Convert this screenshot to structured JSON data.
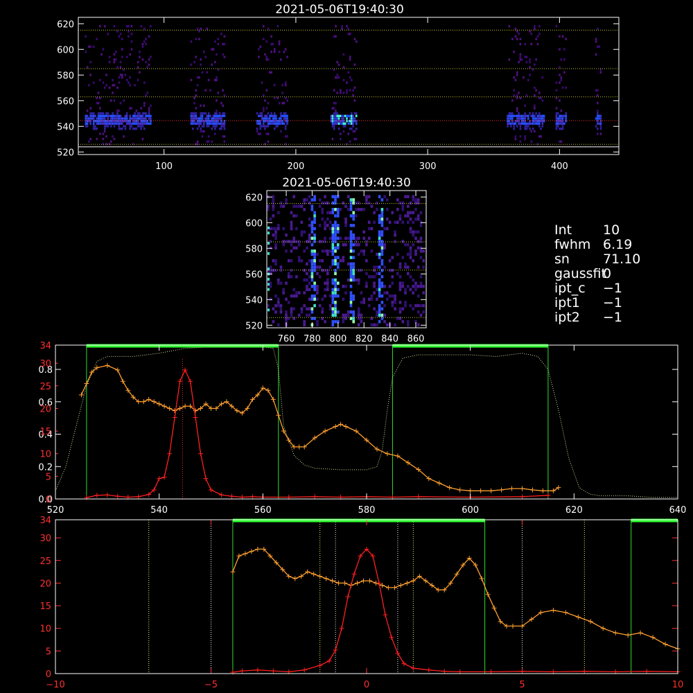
{
  "panel1": {
    "title": "2021-05-06T19:40:30",
    "xticks": [
      100,
      200,
      300,
      400
    ],
    "yticks": [
      520,
      540,
      560,
      580,
      600,
      620
    ],
    "xlim": [
      35,
      445
    ],
    "ylim": [
      518,
      625
    ],
    "hlines": [
      {
        "y": 615,
        "color": "#c8c832"
      },
      {
        "y": 585,
        "color": "#c8c832"
      },
      {
        "y": 563,
        "color": "#c8c832"
      },
      {
        "y": 544.5,
        "color": "#ff3030"
      },
      {
        "y": 526,
        "color": "#c8c832"
      },
      {
        "y": 524,
        "color": "#ffffff"
      }
    ],
    "bands": [
      [
        40,
        90
      ],
      [
        120,
        146
      ],
      [
        170,
        193
      ],
      [
        226,
        246
      ],
      [
        360,
        388
      ],
      [
        397,
        405
      ],
      [
        427,
        431
      ]
    ]
  },
  "panel2": {
    "title": "2021-05-06T19:40:30",
    "xticks": [
      760,
      780,
      800,
      820,
      840,
      860
    ],
    "yticks": [
      520,
      540,
      560,
      580,
      600,
      620
    ],
    "xlim": [
      745,
      868
    ],
    "ylim": [
      518,
      625
    ],
    "hlines": [
      {
        "y": 615,
        "color": "#c8c832"
      },
      {
        "y": 585,
        "color": "#c8c832"
      },
      {
        "y": 563,
        "color": "#c8c832"
      },
      {
        "y": 526,
        "color": "#c8c832"
      }
    ],
    "streaks": [
      780,
      797,
      810,
      832
    ]
  },
  "info": [
    {
      "key": "Int",
      "value": "10"
    },
    {
      "key": "fwhm",
      "value": "6.19"
    },
    {
      "key": "sn",
      "value": "71.10"
    },
    {
      "key": "gaussfit",
      "value": "0"
    },
    {
      "key": "ipt_c",
      "value": "−1"
    },
    {
      "key": "ipt1",
      "value": "−1"
    },
    {
      "key": "ipt2",
      "value": "−1"
    }
  ],
  "chart_data": [
    {
      "type": "line",
      "xlim": [
        520,
        640
      ],
      "ylim_left": [
        0,
        0.95
      ],
      "ylim_right": [
        0,
        34
      ],
      "xticks": [
        520,
        540,
        560,
        580,
        600,
        620,
        640
      ],
      "yticks_left": [
        "0.0",
        "0.2",
        "0.4",
        "0.6",
        "0.8"
      ],
      "yticks_right": [
        "0",
        "5",
        "10",
        "15",
        "20",
        "25",
        "30",
        "34"
      ],
      "filter_windows": [
        [
          526,
          563
        ],
        [
          585,
          615
        ]
      ],
      "line_center": 544.5,
      "series": [
        {
          "color": "#ff2020",
          "x": [
            526,
            528,
            530,
            532,
            534,
            536,
            538,
            539,
            540,
            541,
            542,
            543,
            544,
            545,
            546,
            547,
            548,
            549,
            550,
            552,
            554,
            556,
            558,
            560,
            565,
            570,
            575,
            580,
            585,
            590,
            600,
            610,
            615
          ],
          "y": [
            0.3,
            0.8,
            0.9,
            0.6,
            0.4,
            0.5,
            1.0,
            2.0,
            4.5,
            4.8,
            10,
            18,
            26,
            28.5,
            26,
            18,
            10,
            4.5,
            2.0,
            0.9,
            0.6,
            0.4,
            0.5,
            0.4,
            0.4,
            0.5,
            0.4,
            0.5,
            0.4,
            0.5,
            0.4,
            0.5,
            0.8
          ]
        },
        {
          "color": "#ffa030",
          "x": [
            525,
            526,
            527,
            528,
            530,
            532,
            533,
            534,
            535,
            536,
            537,
            538,
            539,
            540,
            541,
            542,
            543,
            544,
            545,
            546,
            547,
            548,
            549,
            550,
            551,
            552,
            553,
            554,
            555,
            556,
            557,
            558,
            559,
            560,
            561,
            562,
            563,
            564,
            565,
            566,
            567,
            568,
            570,
            572,
            574,
            575,
            576,
            578,
            580,
            582,
            584,
            586,
            588,
            590,
            592,
            594,
            596,
            598,
            600,
            602,
            604,
            606,
            608,
            610,
            612,
            614,
            616,
            617
          ],
          "y": [
            23,
            25.5,
            28,
            29,
            29.5,
            28.5,
            26,
            24,
            22.5,
            21.5,
            21.5,
            22,
            21.5,
            21,
            20.5,
            20,
            19.5,
            20,
            20.5,
            20.5,
            19.5,
            20,
            21,
            20,
            20,
            21,
            21.5,
            20.5,
            19.5,
            19,
            20,
            22,
            23,
            24.5,
            24,
            22,
            18.5,
            15,
            13,
            11.5,
            11.5,
            11.5,
            13.5,
            15,
            16,
            16.5,
            16,
            15,
            13,
            11,
            10,
            9.5,
            8,
            6.5,
            4.5,
            3.5,
            2.5,
            2,
            1.8,
            1.8,
            1.8,
            2,
            2.3,
            2.3,
            2,
            1.8,
            1.8,
            2.5
          ]
        },
        {
          "color": "#d0e8a0",
          "dotted": true,
          "x": [
            520,
            522,
            524,
            526,
            528,
            530,
            535,
            540,
            545,
            550,
            555,
            560,
            562,
            563,
            564,
            566,
            568,
            570,
            575,
            580,
            582,
            583,
            584,
            585,
            587,
            590,
            595,
            600,
            605,
            610,
            613,
            615,
            617,
            619,
            621,
            623,
            625,
            630,
            635,
            640
          ],
          "y": [
            0.05,
            0.2,
            0.45,
            0.7,
            0.85,
            0.88,
            0.88,
            0.9,
            0.93,
            0.94,
            0.94,
            0.94,
            0.93,
            0.8,
            0.45,
            0.27,
            0.21,
            0.19,
            0.18,
            0.18,
            0.2,
            0.3,
            0.55,
            0.75,
            0.87,
            0.89,
            0.89,
            0.89,
            0.88,
            0.9,
            0.88,
            0.8,
            0.55,
            0.25,
            0.07,
            0.03,
            0.02,
            0.02,
            0.01,
            0.01
          ]
        }
      ]
    },
    {
      "type": "line",
      "xlim": [
        -10,
        10
      ],
      "ylim": [
        0,
        34
      ],
      "xticks": [
        -10,
        -5,
        0,
        5,
        10
      ],
      "yticks": [
        "0",
        "5",
        "10",
        "15",
        "20",
        "25",
        "30",
        "34"
      ],
      "filter_windows": [
        [
          -4.3,
          3.8
        ],
        [
          8.5,
          10
        ]
      ],
      "vlines_white": [
        -5,
        -1,
        1,
        5
      ],
      "vlines_yellow": [
        -7,
        -1.5,
        1.5,
        7
      ],
      "series": [
        {
          "color": "#ff2020",
          "x": [
            -4.3,
            -4.0,
            -3.5,
            -3.0,
            -2.5,
            -2.0,
            -1.5,
            -1.2,
            -1.0,
            -0.8,
            -0.6,
            -0.4,
            -0.2,
            0.0,
            0.2,
            0.4,
            0.6,
            0.8,
            1.0,
            1.2,
            1.5,
            2.0,
            2.5,
            3.0,
            4.0,
            5.0,
            6.0,
            7.0,
            8.0,
            9.0,
            10.0
          ],
          "y": [
            0.3,
            0.6,
            0.8,
            0.6,
            0.4,
            0.8,
            1.8,
            2.8,
            5.2,
            10,
            17,
            22,
            26,
            27.5,
            26,
            20,
            13,
            8,
            4.5,
            2.2,
            1.2,
            0.8,
            0.5,
            0.4,
            0.4,
            0.5,
            0.4,
            0.5,
            0.4,
            0.5,
            0.4
          ]
        },
        {
          "color": "#ffa030",
          "x": [
            -4.3,
            -4.1,
            -3.9,
            -3.7,
            -3.5,
            -3.3,
            -3.1,
            -2.9,
            -2.7,
            -2.5,
            -2.3,
            -2.1,
            -1.9,
            -1.7,
            -1.5,
            -1.3,
            -1.1,
            -0.9,
            -0.7,
            -0.5,
            -0.3,
            -0.1,
            0.1,
            0.3,
            0.5,
            0.7,
            0.9,
            1.1,
            1.3,
            1.5,
            1.7,
            1.9,
            2.1,
            2.3,
            2.5,
            2.7,
            2.9,
            3.1,
            3.3,
            3.5,
            3.7,
            3.9,
            4.1,
            4.3,
            4.5,
            4.7,
            5.0,
            5.3,
            5.6,
            6.0,
            6.4,
            6.8,
            7.2,
            7.6,
            8.0,
            8.4,
            8.8,
            9.2,
            9.6,
            10.0
          ],
          "y": [
            22.5,
            26,
            26.5,
            27,
            27.5,
            27.5,
            26,
            24.5,
            23,
            21.5,
            21,
            21.5,
            22.5,
            22,
            21.5,
            21,
            20.5,
            20,
            20,
            19.5,
            20,
            20.5,
            20.5,
            20,
            19.5,
            19,
            19,
            19.5,
            20,
            20.5,
            21.5,
            20.5,
            19.5,
            18.5,
            18.5,
            20,
            22,
            24,
            25.5,
            24,
            21,
            17.5,
            14.5,
            11.5,
            10.5,
            10.5,
            10.5,
            12,
            13.5,
            14,
            13.5,
            12.5,
            11.5,
            10,
            9,
            8.5,
            9,
            8,
            6.5,
            5.5
          ]
        }
      ]
    }
  ]
}
